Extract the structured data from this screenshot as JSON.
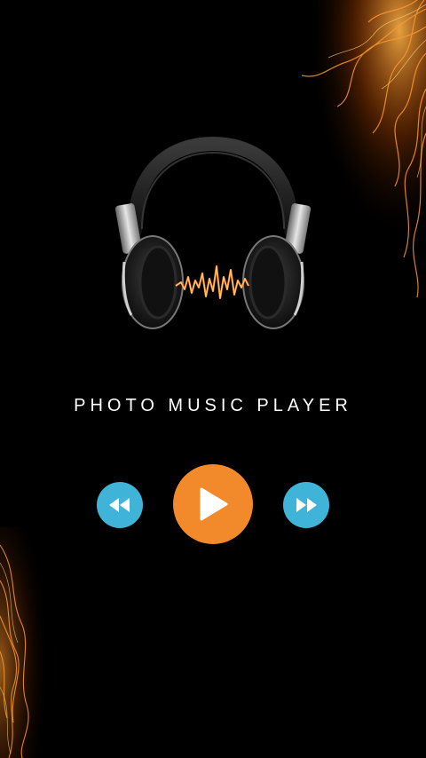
{
  "app": {
    "title": "PHOTO MUSIC PLAYER"
  },
  "controls": {
    "rewind_icon": "rewind-icon",
    "play_icon": "play-icon",
    "forward_icon": "fast-forward-icon"
  },
  "colors": {
    "background": "#000000",
    "play_button": "#f28a2c",
    "skip_buttons": "#40b4d8",
    "title_text": "#ffffff",
    "fire_accent": "#ff8a1c"
  }
}
